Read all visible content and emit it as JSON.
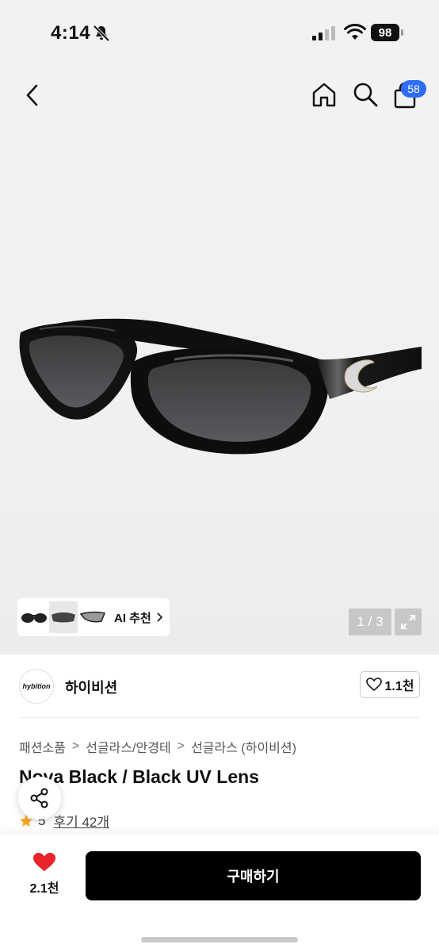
{
  "status_bar": {
    "time": "4:14",
    "battery": "98",
    "icons": [
      "bell-slash-icon",
      "signal-icon",
      "wifi-icon",
      "battery-icon"
    ]
  },
  "nav": {
    "icons": [
      "back-icon",
      "home-icon",
      "search-icon",
      "shopping-bag-icon"
    ],
    "cart_badge": "58",
    "badge_color": "#2f6df6"
  },
  "gallery": {
    "ai_label": "AI 추천",
    "page_indicator": "1 / 3"
  },
  "seller": {
    "logo_text": "hybition",
    "name": "하이비션",
    "likes": "1.1천"
  },
  "breadcrumb": [
    "패션소품",
    "선글라스/안경테",
    "선글라스 (하이비션)"
  ],
  "product": {
    "title": "Nova Black / Black UV Lens",
    "rating": "5",
    "reviews": "후기 42개"
  },
  "bottom_bar": {
    "wish_count": "2.1천",
    "buy_label": "구매하기",
    "wish_color": "#e8232a"
  }
}
